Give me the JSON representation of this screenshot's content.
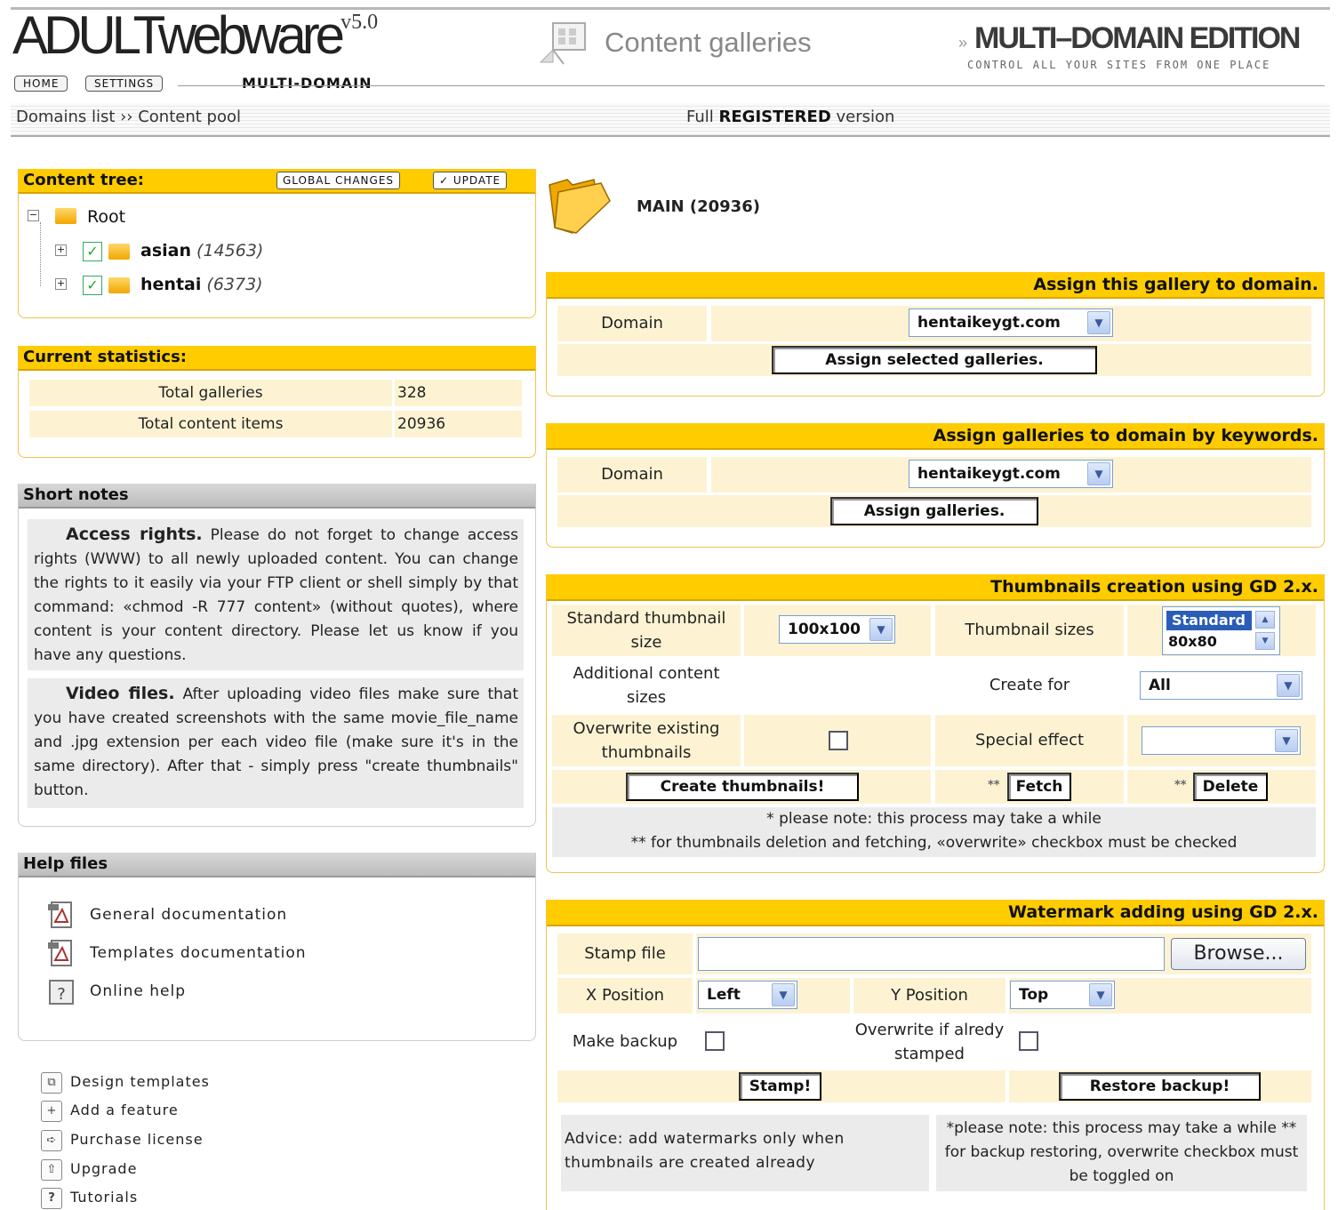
{
  "header": {
    "logo_text": "ADULTwebware",
    "logo_version": "v5.0",
    "home_btn": "HOME",
    "settings_btn": "SETTINGS",
    "multi_domain_label": "MULTI-DOMAIN",
    "section_title": "Content galleries",
    "edition_arrow": "»",
    "edition_title": "MULTI–DOMAIN EDITION",
    "edition_sub": "CONTROL ALL YOUR SITES FROM ONE PLACE",
    "breadcrumb": "Domains list ›› Content pool",
    "version_prefix": "Full ",
    "version_bold": "REGISTERED",
    "version_suffix": " version"
  },
  "content_tree": {
    "title": "Content tree:",
    "global_changes_btn": "GLOBAL CHANGES",
    "update_btn": "✓ UPDATE",
    "root_label": "Root",
    "items": [
      {
        "name": "asian",
        "count": "(14563)",
        "checked": true
      },
      {
        "name": "hentai",
        "count": "(6373)",
        "checked": true
      }
    ]
  },
  "statistics": {
    "title": "Current statistics:",
    "rows": [
      {
        "label": "Total galleries",
        "value": "328"
      },
      {
        "label": "Total content items",
        "value": "20936"
      }
    ]
  },
  "short_notes": {
    "title": "Short notes",
    "note1_bold": "Access rights.",
    "note1_text": " Please do not forget to change access rights (WWW) to all newly uploaded content. You can change the rights to it easily via your FTP client or shell simply by that command: «chmod -R 777 content» (without quotes), where content is your content directory. Please let us know if you have any questions.",
    "note2_bold": "Video files.",
    "note2_text": " After uploading video files make sure that you have created screenshots with the same movie_file_name and .jpg extension per each video file (make sure it's in the same directory). After that - simply press \"create thumbnails\" button."
  },
  "help_files": {
    "title": "Help files",
    "items": [
      "General documentation",
      "Templates documentation",
      "Online help"
    ]
  },
  "footer_links": [
    {
      "icon": "design-icon",
      "glyph": "⧉",
      "label": "Design templates"
    },
    {
      "icon": "add-icon",
      "glyph": "+",
      "label": "Add a feature"
    },
    {
      "icon": "purchase-icon",
      "glyph": "➪",
      "label": "Purchase license"
    },
    {
      "icon": "upgrade-icon",
      "glyph": "⇧",
      "label": "Upgrade"
    },
    {
      "icon": "tutorials-icon",
      "glyph": "?",
      "label": "Tutorials"
    }
  ],
  "main": {
    "title": "MAIN (20936)"
  },
  "assign_gallery": {
    "title": "Assign this gallery to domain.",
    "domain_label": "Domain",
    "domain_value": "hentaikeygt.com",
    "button": "Assign selected galleries."
  },
  "assign_keywords": {
    "title": "Assign galleries to domain by keywords.",
    "domain_label": "Domain",
    "domain_value": "hentaikeygt.com",
    "button": "Assign galleries."
  },
  "thumbnails": {
    "title": "Thumbnails creation using GD 2.x.",
    "std_size_label": "Standard thumbnail size",
    "std_size_value": "100x100",
    "sizes_label": "Thumbnail sizes",
    "sizes_options": [
      "Standard",
      "80x80"
    ],
    "additional_label": "Additional content sizes",
    "create_for_label": "Create for",
    "create_for_value": "All",
    "overwrite_label": "Overwrite existing thumbnails",
    "special_effect_label": "Special effect",
    "special_effect_value": "",
    "create_btn": "Create thumbnails!",
    "fetch_mark": "**",
    "fetch_btn": "Fetch",
    "delete_mark": "**",
    "delete_btn": "Delete",
    "note1": "* please note: this process may take a while",
    "note2": "** for thumbnails deletion and fetching, «overwrite» checkbox must be checked"
  },
  "watermark": {
    "title": "Watermark adding using GD 2.x.",
    "stamp_label": "Stamp file",
    "stamp_value": "",
    "browse_btn": "Browse...",
    "x_label": "X Position",
    "x_value": "Left",
    "y_label": "Y Position",
    "y_value": "Top",
    "backup_label": "Make backup",
    "overwrite_label": "Overwrite if alredy stamped",
    "stamp_btn": "Stamp!",
    "restore_btn": "Restore backup!",
    "advice": "Advice: add watermarks only when thumbnails are created already",
    "note": "*please note: this process may take a while ** for backup restoring, overwrite checkbox must be toggled on"
  },
  "colors": {
    "accent": "#ffcc00",
    "accent_border": "#d9a400",
    "cell_bg": "#fdf3d3",
    "note_bg": "#ebebeb"
  }
}
